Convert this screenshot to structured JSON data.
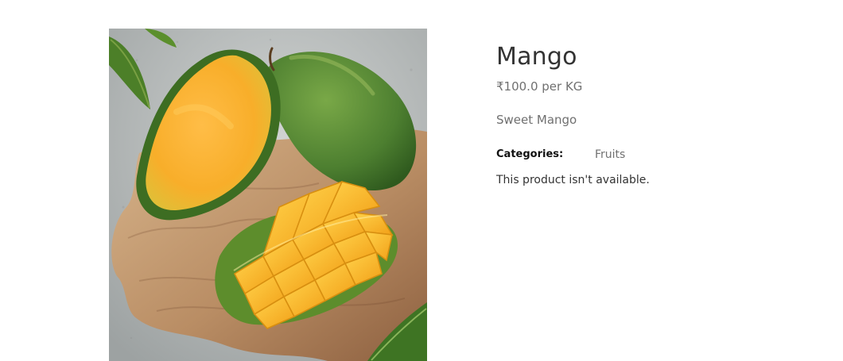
{
  "product": {
    "title": "Mango",
    "price": "₹100.0 per KG",
    "description": "Sweet Mango",
    "categories_label": "Categories:",
    "category": "Fruits",
    "availability": "This product isn't available."
  },
  "colors": {
    "title_text": "#333333",
    "muted_text": "#707070",
    "label_text": "#111111",
    "background": "#ffffff"
  }
}
